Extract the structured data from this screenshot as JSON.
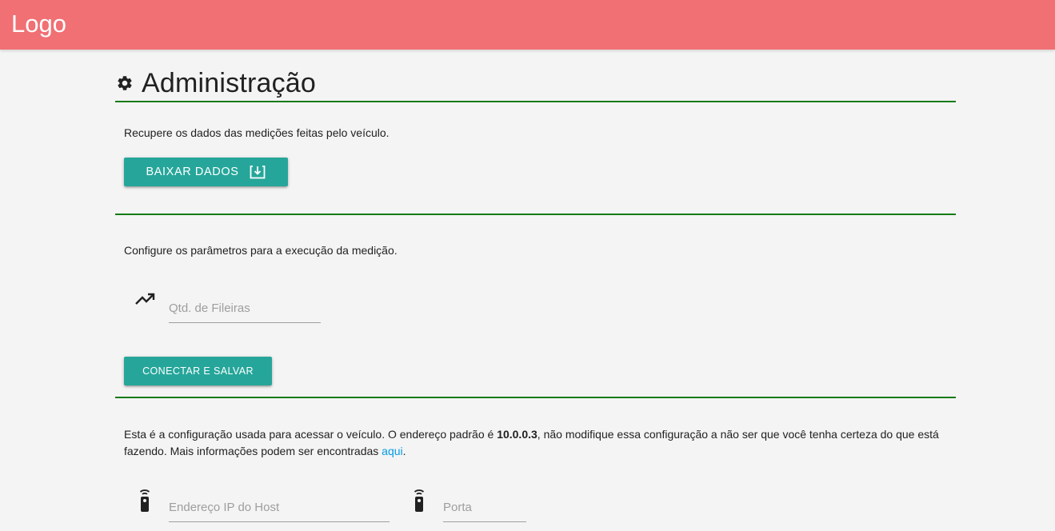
{
  "navbar": {
    "logo": "Logo"
  },
  "page": {
    "title": "Administração",
    "title_icon": "gear-icon"
  },
  "download_section": {
    "description": "Recupere os dados das medições feitas pelo veículo.",
    "button_label": "BAIXAR DADOS",
    "button_icon": "download-icon"
  },
  "params_section": {
    "description": "Configure os parâmetros para a execução da medição.",
    "rows_field": {
      "icon": "trending-up-icon",
      "placeholder": "Qtd. de Fileiras",
      "value": ""
    },
    "button_label": "CONECTAR E SALVAR"
  },
  "connection_section": {
    "text_before": "Esta é a configuração usada para acessar o veículo. O endereço padrão é ",
    "default_address": "10.0.0.3",
    "text_after": ", não modifique essa configuração a não ser que você tenha certeza do que está fazendo. Mais informações podem ser encontradas ",
    "link_label": "aqui",
    "text_end": ".",
    "host_field": {
      "icon": "remote-icon",
      "placeholder": "Endereço IP do Host",
      "value": ""
    },
    "port_field": {
      "icon": "remote-icon",
      "placeholder": "Porta",
      "value": ""
    }
  },
  "colors": {
    "navbar": "#f07074",
    "divider": "#137a13",
    "button": "#26a69a",
    "link": "#039be5"
  }
}
